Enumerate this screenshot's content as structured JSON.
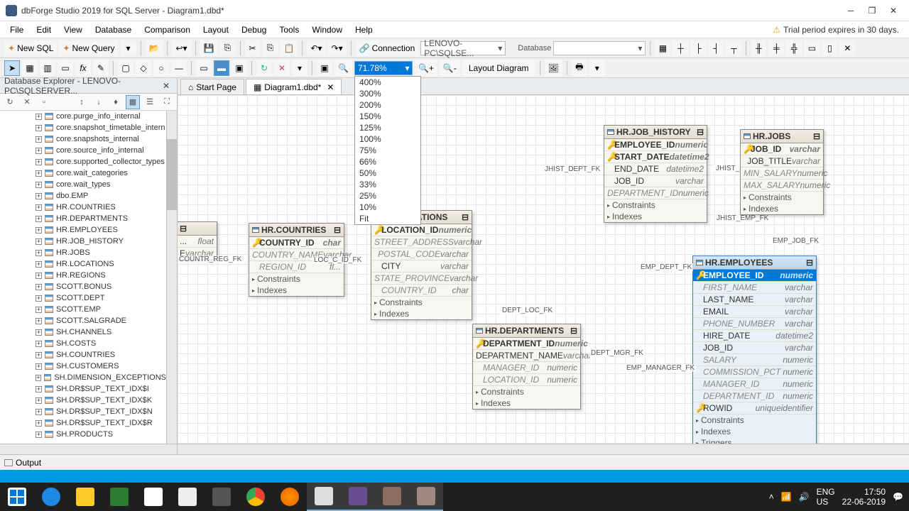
{
  "title": "dbForge Studio 2019 for SQL Server - Diagram1.dbd*",
  "menu": [
    "File",
    "Edit",
    "View",
    "Database",
    "Comparison",
    "Layout",
    "Debug",
    "Tools",
    "Window",
    "Help"
  ],
  "trial": "Trial period expires in 30 days.",
  "toolbar1": {
    "new_sql": "New SQL",
    "new_query": "New Query",
    "connection": "Connection",
    "conn_val": "LENOVO-PC\\SQLSE...",
    "db_label": "Database"
  },
  "toolbar2": {
    "zoom": "71.78%",
    "layout_btn": "Layout Diagram",
    "zoom_opts": [
      "400%",
      "300%",
      "200%",
      "150%",
      "125%",
      "100%",
      "75%",
      "66%",
      "50%",
      "33%",
      "25%",
      "10%",
      "Fit"
    ]
  },
  "explorer": {
    "title": "Database Explorer - LENOVO-PC\\SQLSERVER...",
    "nodes": [
      "core.purge_info_internal",
      "core.snapshot_timetable_intern",
      "core.snapshots_internal",
      "core.source_info_internal",
      "core.supported_collector_types",
      "core.wait_categories",
      "core.wait_types",
      "dbo.EMP",
      "HR.COUNTRIES",
      "HR.DEPARTMENTS",
      "HR.EMPLOYEES",
      "HR.JOB_HISTORY",
      "HR.JOBS",
      "HR.LOCATIONS",
      "HR.REGIONS",
      "SCOTT.BONUS",
      "SCOTT.DEPT",
      "SCOTT.EMP",
      "SCOTT.SALGRADE",
      "SH.CHANNELS",
      "SH.COSTS",
      "SH.COUNTRIES",
      "SH.CUSTOMERS",
      "SH.DIMENSION_EXCEPTIONS",
      "SH.DR$SUP_TEXT_IDX$I",
      "SH.DR$SUP_TEXT_IDX$K",
      "SH.DR$SUP_TEXT_IDX$N",
      "SH.DR$SUP_TEXT_IDX$R",
      "SH.PRODUCTS"
    ]
  },
  "tabs": {
    "start": "Start Page",
    "diagram": "Diagram1.dbd*"
  },
  "fk": {
    "countr_reg": "COUNTR_REG_FK",
    "loc_c": "LOC_C_ID_FK",
    "dept_loc": "DEPT_LOC_FK",
    "dept_mgr": "DEPT_MGR_FK",
    "emp_dept": "EMP_DEPT_FK",
    "emp_mgr": "EMP_MANAGER_FK",
    "emp_job": "EMP_JOB_FK",
    "jhist_dept": "JHIST_DEPT_FK",
    "jhist_job": "JHIST_JOB_FK",
    "jhist_emp": "JHIST_EMP_FK"
  },
  "entities": {
    "regions": {
      "title": "",
      "cols": [
        [
          "...",
          "float"
        ],
        [
          "E",
          "varchar"
        ]
      ]
    },
    "countries": {
      "title": "HR.COUNTRIES",
      "cols": [
        [
          "COUNTRY_ID",
          "char"
        ],
        [
          "COUNTRY_NAME",
          "varchar"
        ],
        [
          "REGION_ID",
          "fl..."
        ]
      ],
      "secs": [
        "Constraints",
        "Indexes"
      ]
    },
    "locations": {
      "title": "HR.LOCATIONS",
      "cols": [
        [
          "LOCATION_ID",
          "numeric"
        ],
        [
          "STREET_ADDRESS",
          "varchar"
        ],
        [
          "POSTAL_CODE",
          "varchar"
        ],
        [
          "CITY",
          "varchar"
        ],
        [
          "STATE_PROVINCE",
          "varchar"
        ],
        [
          "COUNTRY_ID",
          "char"
        ]
      ],
      "secs": [
        "Constraints",
        "Indexes"
      ]
    },
    "departments": {
      "title": "HR.DEPARTMENTS",
      "cols": [
        [
          "DEPARTMENT_ID",
          "numeric"
        ],
        [
          "DEPARTMENT_NAME",
          "varchar"
        ],
        [
          "MANAGER_ID",
          "numeric"
        ],
        [
          "LOCATION_ID",
          "numeric"
        ]
      ],
      "secs": [
        "Constraints",
        "Indexes"
      ]
    },
    "job_history": {
      "title": "HR.JOB_HISTORY",
      "cols": [
        [
          "EMPLOYEE_ID",
          "numeric"
        ],
        [
          "START_DATE",
          "datetime2"
        ],
        [
          "END_DATE",
          "datetime2"
        ],
        [
          "JOB_ID",
          "varchar"
        ],
        [
          "DEPARTMENT_ID",
          "numeric"
        ]
      ],
      "secs": [
        "Constraints",
        "Indexes"
      ]
    },
    "jobs": {
      "title": "HR.JOBS",
      "cols": [
        [
          "JOB_ID",
          "varchar"
        ],
        [
          "JOB_TITLE",
          "varchar"
        ],
        [
          "MIN_SALARY",
          "numeric"
        ],
        [
          "MAX_SALARY",
          "numeric"
        ]
      ],
      "secs": [
        "Constraints",
        "Indexes"
      ]
    },
    "employees": {
      "title": "HR.EMPLOYEES",
      "cols": [
        [
          "EMPLOYEE_ID",
          "numeric"
        ],
        [
          "FIRST_NAME",
          "varchar"
        ],
        [
          "LAST_NAME",
          "varchar"
        ],
        [
          "EMAIL",
          "varchar"
        ],
        [
          "PHONE_NUMBER",
          "varchar"
        ],
        [
          "HIRE_DATE",
          "datetime2"
        ],
        [
          "JOB_ID",
          "varchar"
        ],
        [
          "SALARY",
          "numeric"
        ],
        [
          "COMMISSION_PCT",
          "numeric"
        ],
        [
          "MANAGER_ID",
          "numeric"
        ],
        [
          "DEPARTMENT_ID",
          "numeric"
        ],
        [
          "ROWID",
          "uniqueidentifier"
        ]
      ],
      "secs": [
        "Constraints",
        "Indexes",
        "Triggers"
      ]
    }
  },
  "output": "Output",
  "tray": {
    "lang": "ENG",
    "kbd": "US",
    "time": "17:50",
    "date": "22-06-2019"
  }
}
